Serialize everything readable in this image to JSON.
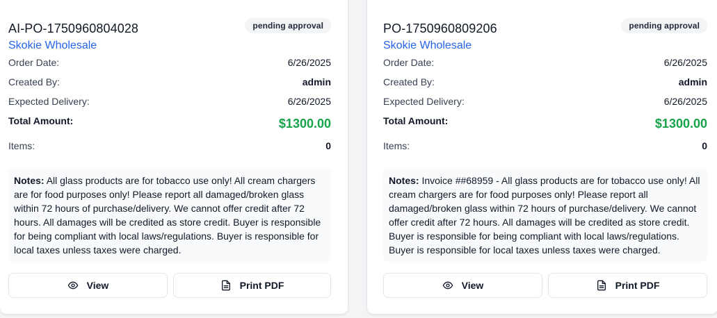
{
  "orders": [
    {
      "po_number": "AI-PO-1750960804028",
      "status": "pending approval",
      "supplier": "Skokie Wholesale",
      "order_date_label": "Order Date:",
      "order_date": "6/26/2025",
      "created_by_label": "Created By:",
      "created_by": "admin",
      "expected_delivery_label": "Expected Delivery:",
      "expected_delivery": "6/26/2025",
      "total_label": "Total Amount:",
      "total": "$1300.00",
      "items_label": "Items:",
      "items": "0",
      "notes_label": "Notes:",
      "notes": "All glass products are for tobacco use only! All cream chargers are for food purposes only! Please report all damaged/broken glass within 72 hours of purchase/delivery. We cannot offer credit after 72 hours. All damages will be credited as store credit. Buyer is responsible for being compliant with local laws/regulations. Buyer is responsible for local taxes unless taxes were charged.",
      "view_label": "View",
      "pdf_label": "Print PDF"
    },
    {
      "po_number": "PO-1750960809206",
      "status": "pending approval",
      "supplier": "Skokie Wholesale",
      "order_date_label": "Order Date:",
      "order_date": "6/26/2025",
      "created_by_label": "Created By:",
      "created_by": "admin",
      "expected_delivery_label": "Expected Delivery:",
      "expected_delivery": "6/26/2025",
      "total_label": "Total Amount:",
      "total": "$1300.00",
      "items_label": "Items:",
      "items": "0",
      "notes_label": "Notes:",
      "notes": "Invoice ##68959 - All glass products are for tobacco use only! All cream chargers are for food purposes only! Please report all damaged/broken glass within 72 hours of purchase/delivery. We cannot offer credit after 72 hours. All damages will be credited as store credit. Buyer is responsible for being compliant with local laws/regulations. Buyer is responsible for local taxes unless taxes were charged.",
      "view_label": "View",
      "pdf_label": "Print PDF"
    }
  ],
  "icons": {
    "view": "eye-icon",
    "pdf": "file-text-icon"
  },
  "colors": {
    "supplier_link": "#2563eb",
    "total_amount": "#16a34a",
    "badge_bg": "#f3f4f6"
  }
}
